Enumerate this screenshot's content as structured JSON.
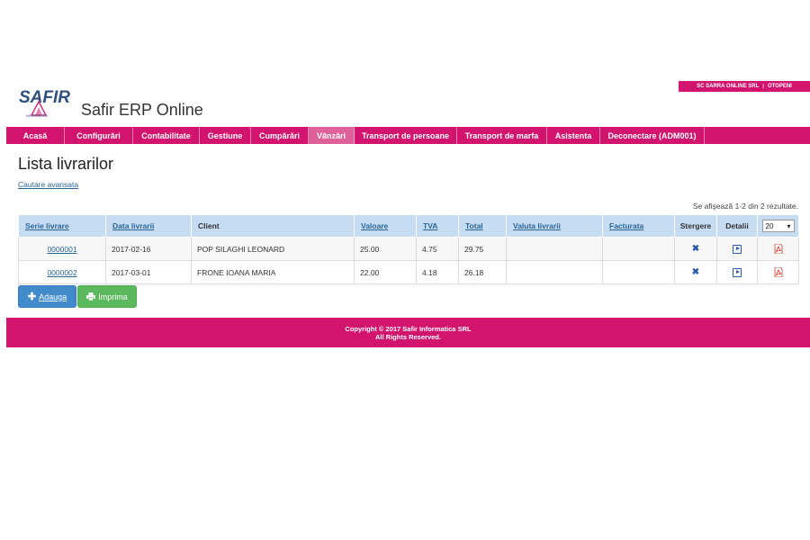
{
  "company": {
    "name": "SC SARRA ONLINE SRL",
    "location": "OTOPENI"
  },
  "logo": {
    "text": "SAFIR",
    "subtext": "INFORMATICA"
  },
  "app_title": "Safir ERP Online",
  "nav": {
    "items": [
      {
        "label": "Acasă"
      },
      {
        "label": "Configurări"
      },
      {
        "label": "Contabilitate"
      },
      {
        "label": "Gestiune"
      },
      {
        "label": "Cumpărări"
      },
      {
        "label": "Vânzări",
        "active": true
      },
      {
        "label": "Transport de persoane"
      },
      {
        "label": "Transport de marfa"
      },
      {
        "label": "Asistenta"
      },
      {
        "label": "Deconectare (ADM001)"
      }
    ]
  },
  "page": {
    "title": "Lista livrarilor",
    "advanced_search": "Cautare avansata",
    "results_info": "Se afişează 1-2 din 2 rezultate."
  },
  "table": {
    "headers": {
      "serie": "Serie livrare",
      "data": "Data livrarii",
      "client": "Client",
      "valoare": "Valoare",
      "tva": "TVA",
      "total": "Total",
      "valuta": "Valuta livrarii",
      "facturata": "Facturata",
      "stergere": "Stergere",
      "detalii": "Detalii"
    },
    "page_size": "20",
    "rows": [
      {
        "serie": "0000001",
        "data": "2017-02-16",
        "client": "POP SILAGHI LEONARD",
        "valoare": "25.00",
        "tva": "4.75",
        "total": "29.75",
        "valuta": "",
        "facturata": ""
      },
      {
        "serie": "0000002",
        "data": "2017-03-01",
        "client": "FRONE IOANA MARIA",
        "valoare": "22.00",
        "tva": "4.18",
        "total": "26.18",
        "valuta": "",
        "facturata": ""
      }
    ],
    "icons": {
      "delete": "delete-icon",
      "details": "details-icon",
      "pdf": "pdf-icon"
    }
  },
  "buttons": {
    "add": "Adauga",
    "print": "Imprima"
  },
  "footer": {
    "line1": "Copyright © 2017 Safir Informatica SRL",
    "line2": "All Rights Reserved."
  },
  "colors": {
    "brand": "#d2146e",
    "table_header": "#c5dcf3",
    "add_button": "#428bca",
    "print_button": "#5cb85c"
  }
}
